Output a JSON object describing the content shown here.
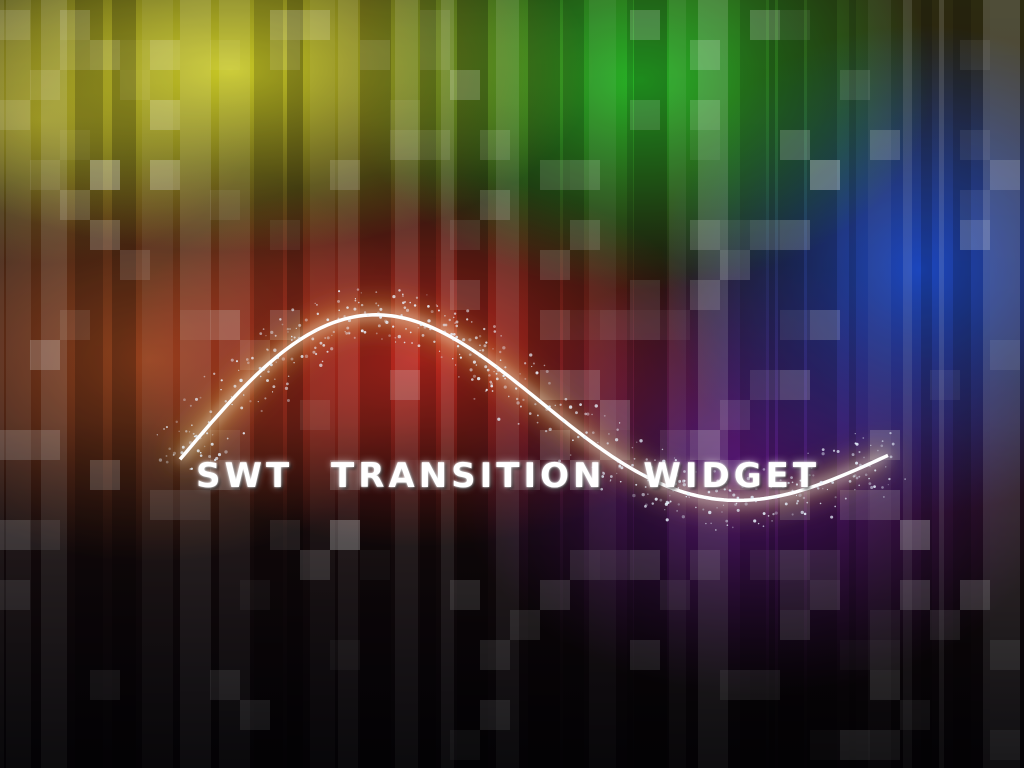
{
  "banner": {
    "title": "SWT TRANSITION WIDGET"
  },
  "colors": {
    "wave_core": "#ffffff",
    "wave_glow": "#ffd84a",
    "sparkle": "#e8f4ff"
  }
}
